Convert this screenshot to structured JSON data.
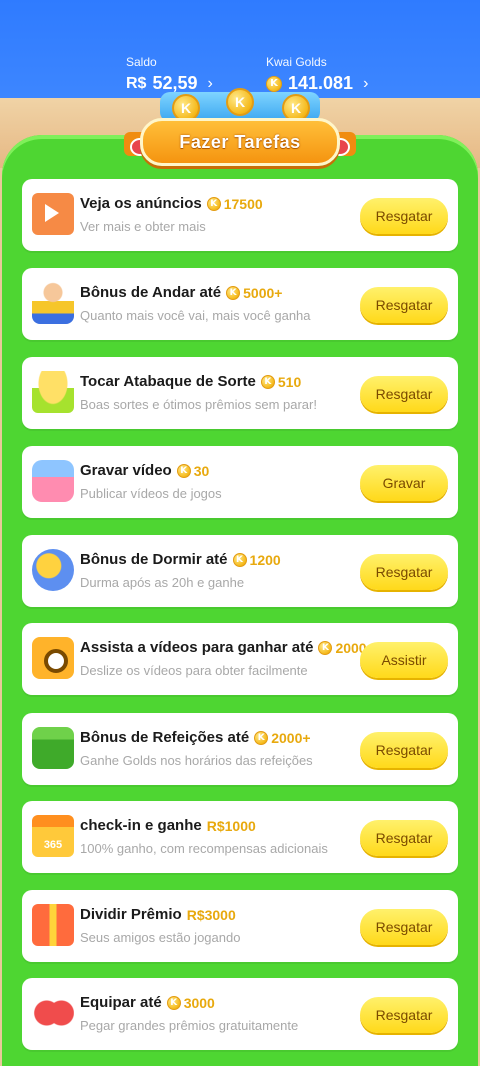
{
  "header": {
    "balance_label": "Saldo",
    "balance_currency": "R$",
    "balance_value": "52,59",
    "golds_label": "Kwai Golds",
    "golds_value": "141.081",
    "chevron": "›"
  },
  "banner": {
    "title": "Fazer Tarefas",
    "coin_glyph": "K"
  },
  "colors": {
    "accent_green": "#4ed632",
    "button_yellow": "#ffd91a",
    "reward_gold": "#e8a90e",
    "top_blue": "#2f7bff"
  },
  "tasks": [
    {
      "icon": "tv-icon",
      "title": "Veja os anúncios",
      "reward": "17500",
      "reward_type": "coin",
      "subtitle": "Ver mais e obter mais",
      "button": "Resgatar"
    },
    {
      "icon": "walking-icon",
      "title": "Bônus de Andar até",
      "reward": "5000+",
      "reward_type": "coin",
      "subtitle": "Quanto mais você vai, mais você ganha",
      "button": "Resgatar"
    },
    {
      "icon": "drum-icon",
      "title": "Tocar Atabaque de Sorte",
      "reward": "510",
      "reward_type": "coin",
      "subtitle": "Boas sortes e ótimos prêmios sem parar!",
      "button": "Resgatar"
    },
    {
      "icon": "video-record-icon",
      "title": "Gravar vídeo",
      "reward": "30",
      "reward_type": "coin",
      "subtitle": "Publicar vídeos de jogos",
      "button": "Gravar"
    },
    {
      "icon": "sleep-icon",
      "title": "Bônus de Dormir até",
      "reward": "1200",
      "reward_type": "coin",
      "subtitle": "Durma após as 20h e ganhe",
      "button": "Resgatar"
    },
    {
      "icon": "camera-icon",
      "title": "Assista a vídeos para ganhar até",
      "reward": "2000",
      "reward_type": "coin",
      "subtitle": "Deslize os vídeos para obter facilmente",
      "button": "Assistir"
    },
    {
      "icon": "meal-icon",
      "title": "Bônus de Refeições até",
      "reward": "2000+",
      "reward_type": "coin",
      "subtitle": "Ganhe Golds nos horários das refeições",
      "button": "Resgatar"
    },
    {
      "icon": "calendar-icon",
      "icon_text": "365",
      "title": "check-in e ganhe",
      "reward": "R$1000",
      "reward_type": "cash",
      "subtitle": "100% ganho, com recompensas adicionais",
      "button": "Resgatar"
    },
    {
      "icon": "gift-icon",
      "title": "Dividir Prêmio",
      "reward": "R$3000",
      "reward_type": "cash",
      "subtitle": "Seus amigos estão jogando",
      "button": "Resgatar"
    },
    {
      "icon": "boxing-glove-icon",
      "title": "Equipar até",
      "reward": "3000",
      "reward_type": "coin",
      "subtitle": "Pegar grandes prêmios gratuitamente",
      "button": "Resgatar"
    }
  ]
}
